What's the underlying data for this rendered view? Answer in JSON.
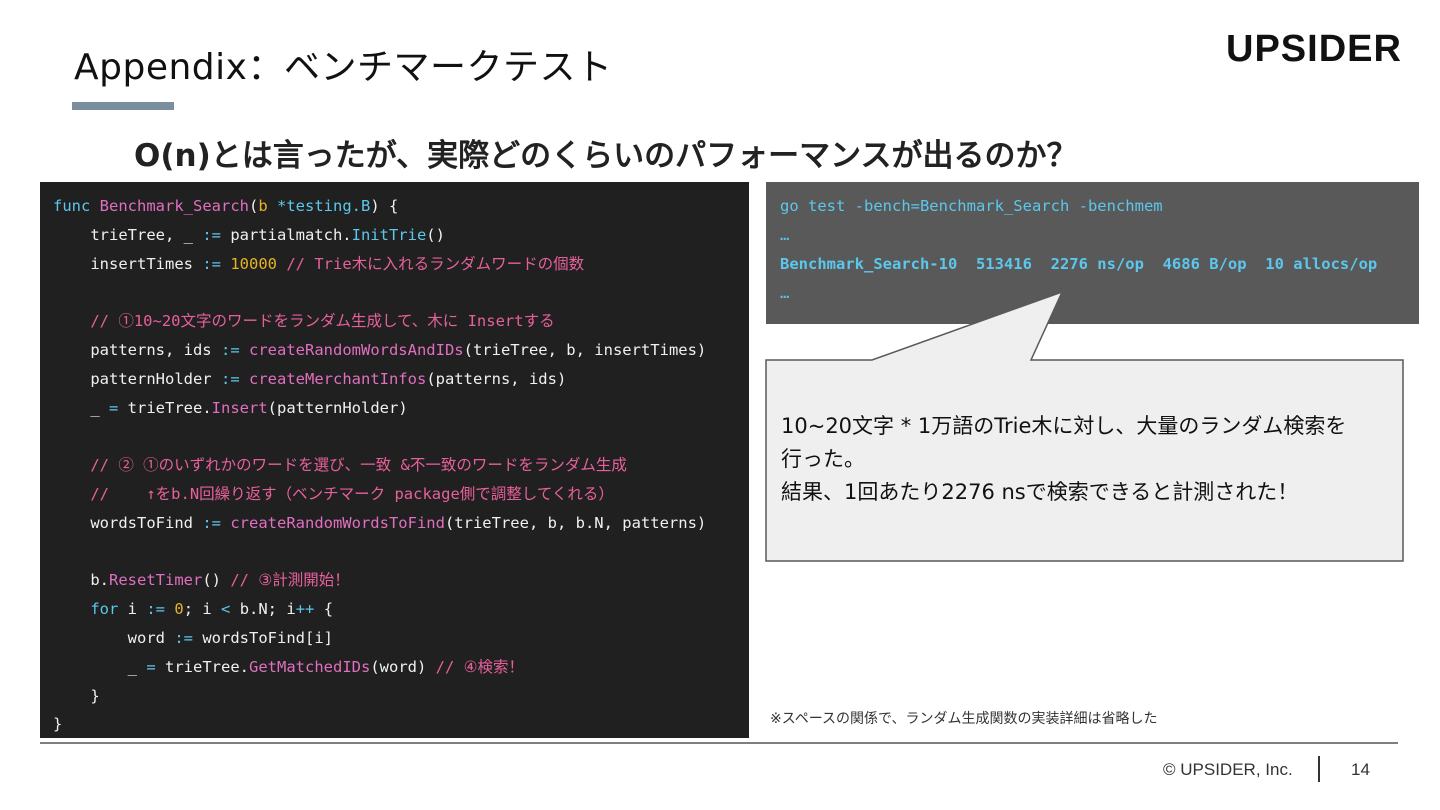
{
  "header": {
    "title": "Appendix：ベンチマークテスト",
    "logo": "UPSIDER"
  },
  "subtitle": "O(n)とは言ったが、実際どのくらいのパフォーマンスが出るのか？",
  "code": {
    "l1": {
      "a": "func ",
      "b": "Benchmark_Search",
      "c": "(",
      "d": "b",
      "e": " *",
      "f": "testing",
      "g": ".B",
      ") {": ") {"
    },
    "l1a": "func ",
    "l1b": "Benchmark_Search",
    "l1c": "(",
    "l1d": "b",
    "l1e": " *testing.B",
    "l1f": ") {",
    "l2a": "    trieTree, _ ",
    "l2b": ":=",
    "l2c": " partialmatch.",
    "l2d": "InitTrie",
    "l2e": "()",
    "l3a": "    insertTimes ",
    "l3b": ":=",
    "l3c": " ",
    "l3d": "10000",
    "l3e": " // Trie木に入れるランダムワードの個数",
    "l5a": "    // ①10~20文字のワードをランダム生成して、木に Insertする",
    "l6a": "    patterns, ids ",
    "l6b": ":=",
    "l6c": " ",
    "l6d": "createRandomWordsAndIDs",
    "l6e": "(trieTree, b, insertTimes)",
    "l7a": "    patternHolder ",
    "l7b": ":=",
    "l7c": " ",
    "l7d": "createMerchantInfos",
    "l7e": "(patterns, ids)",
    "l8a": "    _ ",
    "l8b": "=",
    "l8c": " trieTree.",
    "l8d": "Insert",
    "l8e": "(patternHolder)",
    "l10a": "    // ② ①のいずれかのワードを選び、一致 &不一致のワードをランダム生成",
    "l11a": "    //    ↑をb.N回繰り返す（ベンチマーク package側で調整してくれる）",
    "l12a": "    wordsToFind ",
    "l12b": ":=",
    "l12c": " ",
    "l12d": "createRandomWordsToFind",
    "l12e": "(trieTree, b, b.N, patterns)",
    "l14a": "    b.",
    "l14b": "ResetTimer",
    "l14c": "() ",
    "l14d": "// ③計測開始！",
    "l15a": "    ",
    "l15b": "for",
    "l15c": " i ",
    "l15d": ":=",
    "l15e": " ",
    "l15f": "0",
    "l15g": "; i ",
    "l15h": "<",
    "l15i": " b.N; i",
    "l15j": "++",
    "l15k": " {",
    "l16a": "        word ",
    "l16b": ":=",
    "l16c": " wordsToFind[i]",
    "l17a": "        _ ",
    "l17b": "=",
    "l17c": " trieTree.",
    "l17d": "GetMatchedIDs",
    "l17e": "(word) ",
    "l17f": "// ④検索！",
    "l18a": "    }",
    "l19a": "}"
  },
  "terminal": {
    "cmd": "go test -bench=Benchmark_Search -benchmem",
    "ellipsis1": "…",
    "result": "Benchmark_Search-10  513416  2276 ns/op  4686 B/op  10 allocs/op",
    "ellipsis2": "…"
  },
  "callout": {
    "line1": "10~20文字 * 1万語のTrie木に対し、大量のランダム検索を",
    "line2": "行った。",
    "line3": "結果、1回あたり2276 nsで検索できると計測された！"
  },
  "note": "※スペースの関係で、ランダム生成関数の実装詳細は省略した",
  "footer": {
    "copyright": "© UPSIDER, Inc.",
    "page": "14"
  },
  "colors": {
    "code_bg": "#202020",
    "terminal_bg": "#595959",
    "keyword": "#5cc7ec",
    "function": "#e06fc0",
    "number": "#e6b422",
    "comment": "#e8609b",
    "accent_bar": "#7a8f9e"
  }
}
